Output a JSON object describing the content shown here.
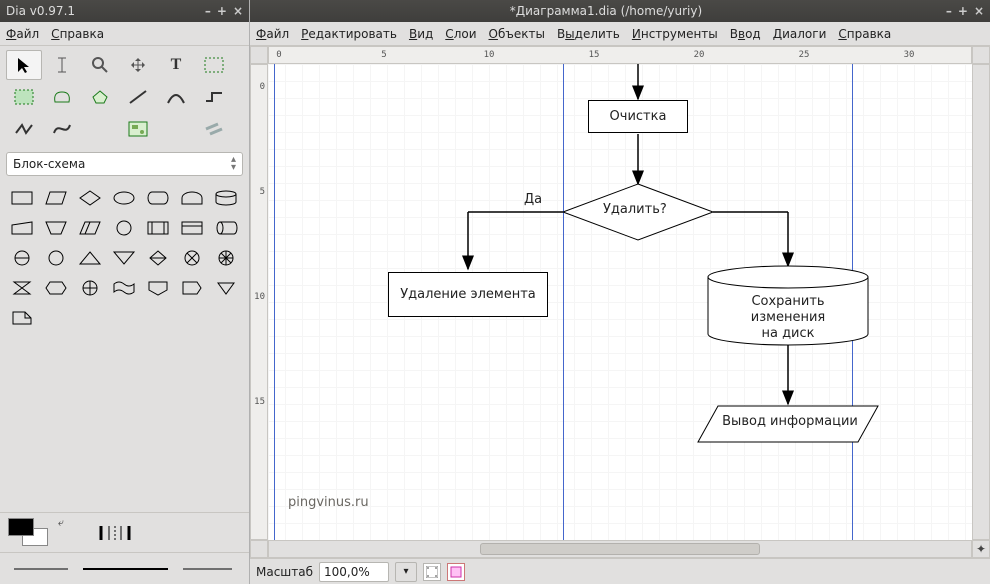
{
  "toolbox": {
    "title": "Dia v0.97.1",
    "menu": {
      "file": "Файл",
      "help": "Справка"
    },
    "win_min": "–",
    "win_max": "+",
    "win_close": "×",
    "category": "Блок-схема",
    "tools": [
      {
        "name": "pointer-tool",
        "icon": "arrow"
      },
      {
        "name": "text-edit-tool",
        "icon": "ibeam"
      },
      {
        "name": "magnify-tool",
        "icon": "zoom"
      },
      {
        "name": "scroll-tool",
        "icon": "move"
      },
      {
        "name": "text-tool",
        "icon": "T"
      },
      {
        "name": "box-tool",
        "icon": "box"
      },
      {
        "name": "ellipse-tool",
        "icon": "ellipse"
      },
      {
        "name": "polygon-tool",
        "icon": "poly"
      },
      {
        "name": "beziergon-tool",
        "icon": "bezpoly"
      },
      {
        "name": "line-tool",
        "icon": "line"
      },
      {
        "name": "arc-tool",
        "icon": "arc"
      },
      {
        "name": "zigzag-tool",
        "icon": "zig"
      },
      {
        "name": "polyline-tool",
        "icon": "polyline"
      },
      {
        "name": "bezier-tool",
        "icon": "bez"
      },
      {
        "name": "image-tool",
        "icon": "image"
      },
      {
        "name": "outline-tool",
        "icon": "ghost"
      }
    ],
    "shapes": [
      "process",
      "data",
      "decision",
      "terminator",
      "predefined",
      "preparation",
      "manual-input",
      "manual-operation",
      "display",
      "off-page",
      "document",
      "stored-data",
      "internal-storage",
      "database",
      "merge",
      "extract",
      "or",
      "summing",
      "collate",
      "sort",
      "delay",
      "connector",
      "punched-card",
      "punched-tape",
      "magtape",
      "magdisk",
      "magdrum",
      "off-page2"
    ]
  },
  "canvas_window": {
    "title": "*Диаграмма1.dia (/home/yuriy)",
    "win_min": "–",
    "win_max": "+",
    "win_close": "×",
    "menu": {
      "file": "Файл",
      "edit": "Редактировать",
      "view": "Вид",
      "layers": "Слои",
      "objects": "Объекты",
      "select": "Выделить",
      "tools": "Инструменты",
      "input": "Ввод",
      "dialogs": "Диалоги",
      "help": "Справка"
    },
    "hruler_labels": [
      "0",
      "5",
      "10",
      "15",
      "20",
      "25",
      "30"
    ],
    "vruler_labels": [
      "0",
      "5",
      "10",
      "15"
    ],
    "zoom_label": "Масштаб",
    "zoom_value": "100,0%"
  },
  "diagram": {
    "cleanup": "Очистка",
    "delete_q": "Удалить?",
    "yes": "Да",
    "remove_elem": "Удаление элемента",
    "save_disk_l1": "Сохранить изменения",
    "save_disk_l2": "на диск",
    "output_info": "Вывод информации",
    "watermark": "pingvinus.ru"
  }
}
